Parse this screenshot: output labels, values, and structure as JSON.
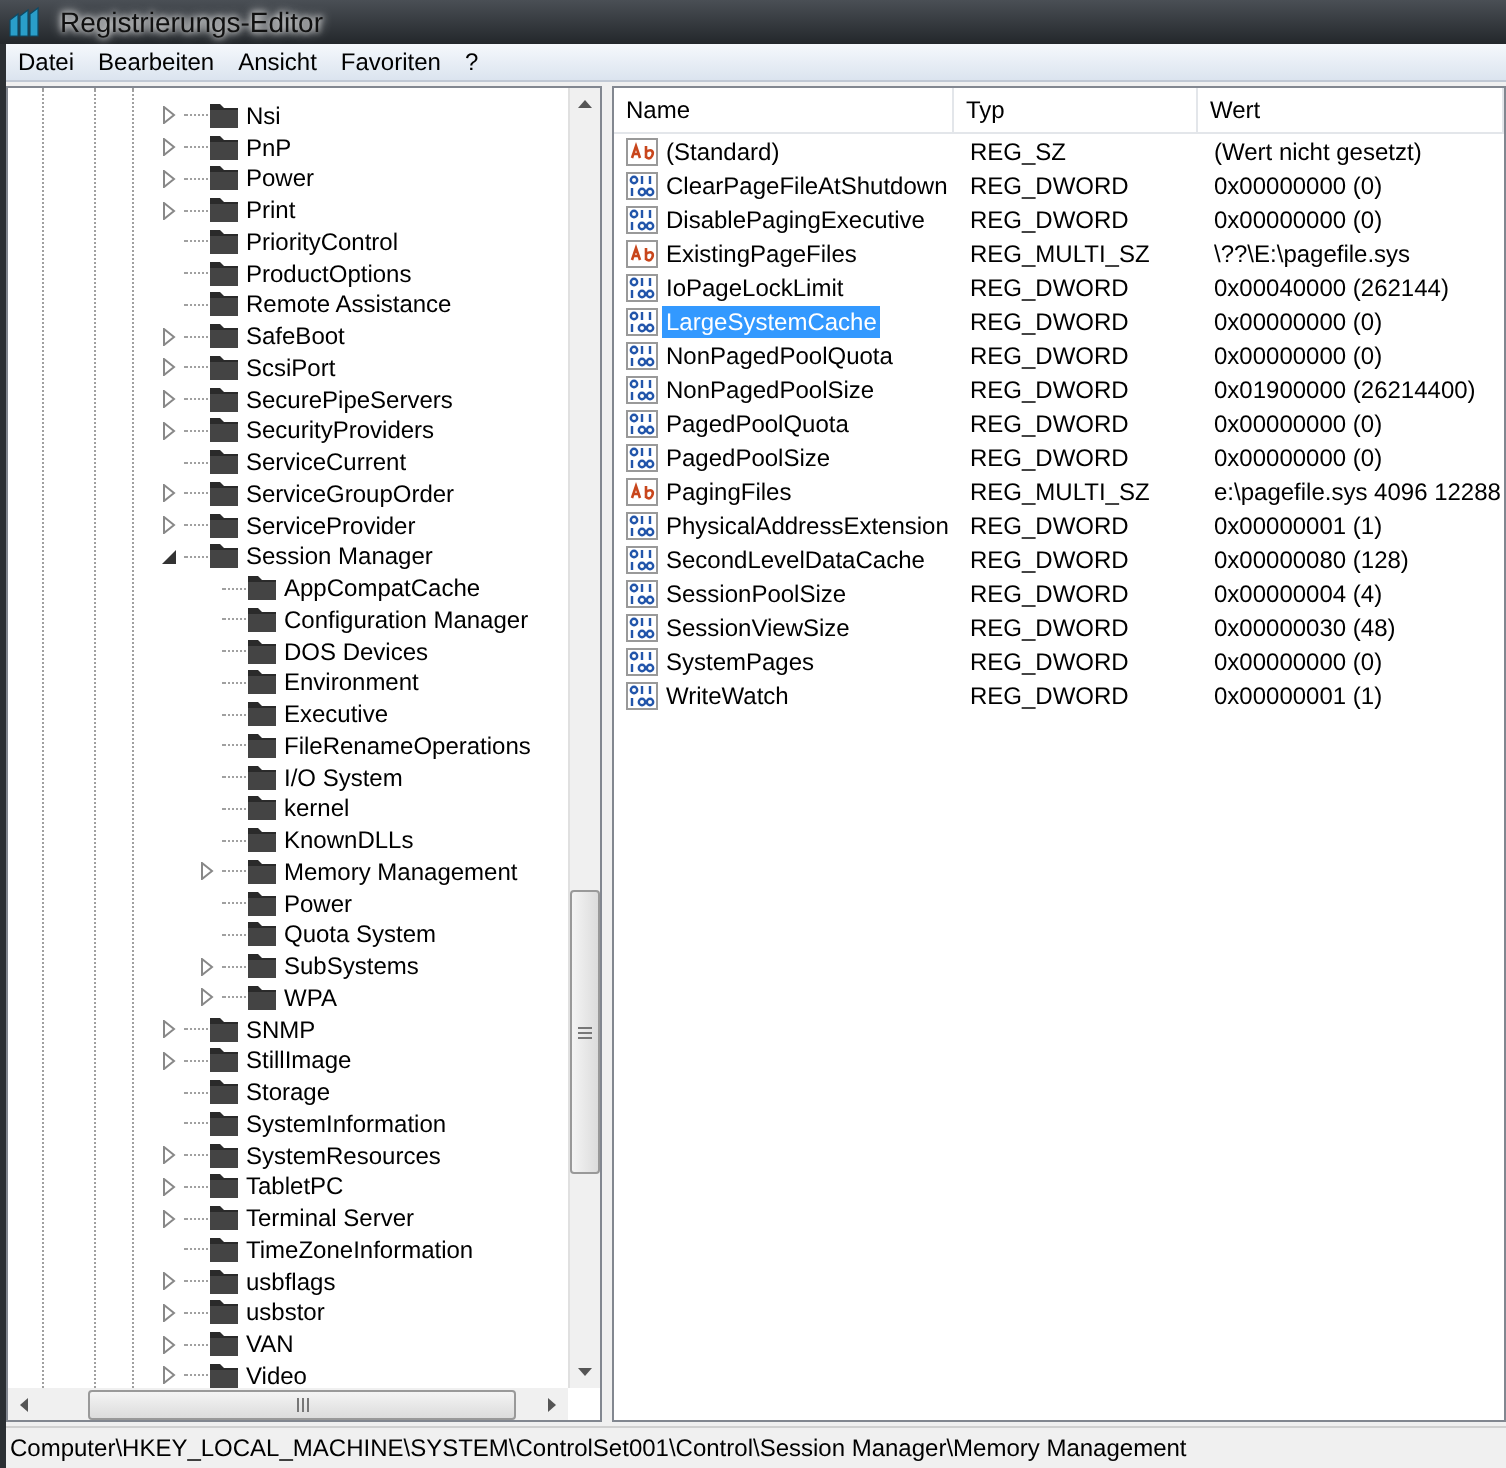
{
  "window": {
    "title": "Registrierungs-Editor"
  },
  "menu": [
    "Datei",
    "Bearbeiten",
    "Ansicht",
    "Favoriten",
    "?"
  ],
  "tree": [
    {
      "label": "Nsi",
      "kind": "node",
      "expanded": false
    },
    {
      "label": "PnP",
      "kind": "node",
      "expanded": false
    },
    {
      "label": "Power",
      "kind": "node",
      "expanded": false
    },
    {
      "label": "Print",
      "kind": "node",
      "expanded": false
    },
    {
      "label": "PriorityControl",
      "kind": "leaf"
    },
    {
      "label": "ProductOptions",
      "kind": "leaf"
    },
    {
      "label": "Remote Assistance",
      "kind": "leaf"
    },
    {
      "label": "SafeBoot",
      "kind": "node",
      "expanded": false
    },
    {
      "label": "ScsiPort",
      "kind": "node",
      "expanded": false
    },
    {
      "label": "SecurePipeServers",
      "kind": "node",
      "expanded": false
    },
    {
      "label": "SecurityProviders",
      "kind": "node",
      "expanded": false
    },
    {
      "label": "ServiceCurrent",
      "kind": "leaf"
    },
    {
      "label": "ServiceGroupOrder",
      "kind": "node",
      "expanded": false
    },
    {
      "label": "ServiceProvider",
      "kind": "node",
      "expanded": false
    },
    {
      "label": "Session Manager",
      "kind": "node",
      "expanded": true,
      "children": [
        {
          "label": "AppCompatCache",
          "kind": "leaf"
        },
        {
          "label": "Configuration Manager",
          "kind": "leaf"
        },
        {
          "label": "DOS Devices",
          "kind": "leaf"
        },
        {
          "label": "Environment",
          "kind": "leaf"
        },
        {
          "label": "Executive",
          "kind": "leaf"
        },
        {
          "label": "FileRenameOperations",
          "kind": "leaf"
        },
        {
          "label": "I/O System",
          "kind": "leaf"
        },
        {
          "label": "kernel",
          "kind": "leaf"
        },
        {
          "label": "KnownDLLs",
          "kind": "leaf"
        },
        {
          "label": "Memory Management",
          "kind": "node",
          "expanded": false
        },
        {
          "label": "Power",
          "kind": "leaf"
        },
        {
          "label": "Quota System",
          "kind": "leaf"
        },
        {
          "label": "SubSystems",
          "kind": "node",
          "expanded": false
        },
        {
          "label": "WPA",
          "kind": "node",
          "expanded": false
        }
      ]
    },
    {
      "label": "SNMP",
      "kind": "node",
      "expanded": false
    },
    {
      "label": "StillImage",
      "kind": "node",
      "expanded": false
    },
    {
      "label": "Storage",
      "kind": "leaf"
    },
    {
      "label": "SystemInformation",
      "kind": "leaf"
    },
    {
      "label": "SystemResources",
      "kind": "node",
      "expanded": false
    },
    {
      "label": "TabletPC",
      "kind": "node",
      "expanded": false
    },
    {
      "label": "Terminal Server",
      "kind": "node",
      "expanded": false
    },
    {
      "label": "TimeZoneInformation",
      "kind": "leaf"
    },
    {
      "label": "usbflags",
      "kind": "node",
      "expanded": false
    },
    {
      "label": "usbstor",
      "kind": "node",
      "expanded": false
    },
    {
      "label": "VAN",
      "kind": "node",
      "expanded": false
    },
    {
      "label": "Video",
      "kind": "node",
      "expanded": false
    }
  ],
  "table": {
    "columns": [
      "Name",
      "Typ",
      "Wert"
    ],
    "rows": [
      {
        "kind": "string",
        "name": "(Standard)",
        "type": "REG_SZ",
        "value": "(Wert nicht gesetzt)",
        "selected": false
      },
      {
        "kind": "binary",
        "name": "ClearPageFileAtShutdown",
        "type": "REG_DWORD",
        "value": "0x00000000 (0)",
        "selected": false
      },
      {
        "kind": "binary",
        "name": "DisablePagingExecutive",
        "type": "REG_DWORD",
        "value": "0x00000000 (0)",
        "selected": false
      },
      {
        "kind": "string",
        "name": "ExistingPageFiles",
        "type": "REG_MULTI_SZ",
        "value": "\\??\\E:\\pagefile.sys",
        "selected": false
      },
      {
        "kind": "binary",
        "name": "IoPageLockLimit",
        "type": "REG_DWORD",
        "value": "0x00040000 (262144)",
        "selected": false
      },
      {
        "kind": "binary",
        "name": "LargeSystemCache",
        "type": "REG_DWORD",
        "value": "0x00000000 (0)",
        "selected": true
      },
      {
        "kind": "binary",
        "name": "NonPagedPoolQuota",
        "type": "REG_DWORD",
        "value": "0x00000000 (0)",
        "selected": false
      },
      {
        "kind": "binary",
        "name": "NonPagedPoolSize",
        "type": "REG_DWORD",
        "value": "0x01900000 (26214400)",
        "selected": false
      },
      {
        "kind": "binary",
        "name": "PagedPoolQuota",
        "type": "REG_DWORD",
        "value": "0x00000000 (0)",
        "selected": false
      },
      {
        "kind": "binary",
        "name": "PagedPoolSize",
        "type": "REG_DWORD",
        "value": "0x00000000 (0)",
        "selected": false
      },
      {
        "kind": "string",
        "name": "PagingFiles",
        "type": "REG_MULTI_SZ",
        "value": "e:\\pagefile.sys 4096 12288",
        "selected": false
      },
      {
        "kind": "binary",
        "name": "PhysicalAddressExtension",
        "type": "REG_DWORD",
        "value": "0x00000001 (1)",
        "selected": false
      },
      {
        "kind": "binary",
        "name": "SecondLevelDataCache",
        "type": "REG_DWORD",
        "value": "0x00000080 (128)",
        "selected": false
      },
      {
        "kind": "binary",
        "name": "SessionPoolSize",
        "type": "REG_DWORD",
        "value": "0x00000004 (4)",
        "selected": false
      },
      {
        "kind": "binary",
        "name": "SessionViewSize",
        "type": "REG_DWORD",
        "value": "0x00000030 (48)",
        "selected": false
      },
      {
        "kind": "binary",
        "name": "SystemPages",
        "type": "REG_DWORD",
        "value": "0x00000000 (0)",
        "selected": false
      },
      {
        "kind": "binary",
        "name": "WriteWatch",
        "type": "REG_DWORD",
        "value": "0x00000001 (1)",
        "selected": false
      }
    ]
  },
  "status_bar": "Computer\\HKEY_LOCAL_MACHINE\\SYSTEM\\ControlSet001\\Control\\Session Manager\\Memory Management"
}
